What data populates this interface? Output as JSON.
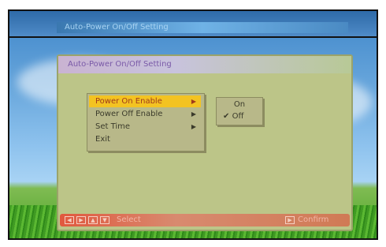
{
  "window": {
    "top_title": "Auto-Power On/Off Setting",
    "panel_title": "Auto-Power On/Off Setting"
  },
  "menu": {
    "items": [
      {
        "label": "Power On Enable",
        "arrow": "▶",
        "selected": true
      },
      {
        "label": "Power Off Enable",
        "arrow": "▶",
        "selected": false
      },
      {
        "label": "Set Time",
        "arrow": "▶",
        "selected": false
      },
      {
        "label": "Exit",
        "arrow": "",
        "selected": false
      }
    ]
  },
  "submenu": {
    "options": [
      {
        "label": "On",
        "check": ""
      },
      {
        "label": "Off",
        "check": "✔"
      }
    ]
  },
  "footer": {
    "select_label": "Select",
    "confirm_label": "Confirm",
    "nav_icons": [
      "left-arrow",
      "right-arrow",
      "up-arrow",
      "down-arrow"
    ]
  }
}
